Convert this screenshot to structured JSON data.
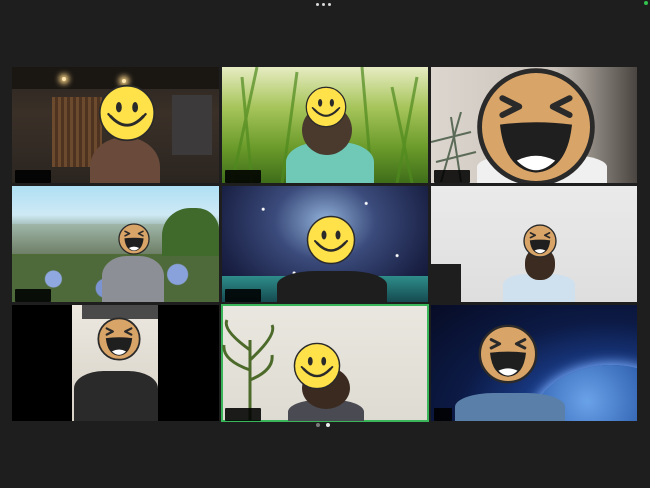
{
  "window": {
    "title": "",
    "top_menu_icon": "more-dots-icon",
    "status_color": "#33c24d"
  },
  "gallery": {
    "active_border_color": "#3ab55a",
    "page_indicator": {
      "current": 2,
      "total": 2
    },
    "participants": [
      {
        "name": "",
        "face": "smiley",
        "active": false
      },
      {
        "name": "",
        "face": "smiley",
        "active": false
      },
      {
        "name": "",
        "face": "laughing",
        "active": false
      },
      {
        "name": "",
        "face": "laughing",
        "active": false
      },
      {
        "name": "",
        "face": "smiley",
        "active": false
      },
      {
        "name": "",
        "face": "laughing",
        "active": false
      },
      {
        "name": "",
        "face": "laughing",
        "active": false
      },
      {
        "name": "",
        "face": "smiley",
        "active": true
      },
      {
        "name": "",
        "face": "laughing",
        "active": false
      }
    ]
  }
}
